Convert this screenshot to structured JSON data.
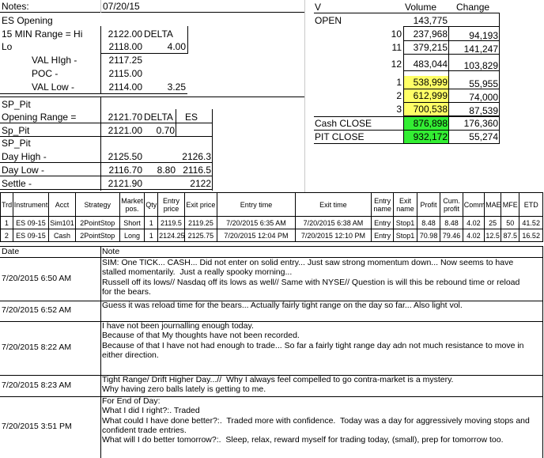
{
  "notes": {
    "label": "Notes:",
    "date": "07/20/15",
    "rows": [
      {
        "label": "ES Opening",
        "value": "",
        "extra_label": "",
        "extra_value": ""
      },
      {
        "label": "15 MIN Range = Hi",
        "value": "2122.00",
        "extra_label": "DELTA",
        "extra_value": ""
      },
      {
        "label": "Lo",
        "value": "2118.00",
        "extra_label": "",
        "extra_value": "4.00"
      },
      {
        "label": "VAL HIgh   -",
        "value": "2117.25",
        "extra_label": "",
        "extra_value": ""
      },
      {
        "label": "POC   -",
        "value": "2115.00",
        "extra_label": "",
        "extra_value": ""
      },
      {
        "label": "VAL Low   -",
        "value": "2114.00",
        "extra_label": "",
        "extra_value": "3.25"
      }
    ]
  },
  "sp_pit": {
    "title": "SP_Pit",
    "opening_range_label": "Opening Range =",
    "opening_range_value": "2121.70",
    "delta_label": "DELTA",
    "es_label": "ES",
    "sp_pit_label": "Sp_Pit",
    "sp_pit_value": "2121.00",
    "sp_pit_delta": "0.70",
    "title2": "SP_Pit",
    "day_high_label": "Day High -",
    "day_high_value": "2125.50",
    "day_high_es": "2126.3",
    "day_low_label": "Day Low -",
    "day_low_value": "2116.70",
    "day_low_delta": "8.80",
    "day_low_es": "2116.5",
    "settle_label": "Settle -",
    "settle_value": "2121.90",
    "settle_es": "2122"
  },
  "volume": {
    "header_v": "V",
    "header_volume": "Volume",
    "header_change": "Change",
    "open_label": "OPEN",
    "open_volume": "143,775",
    "rows": [
      {
        "hour": "10",
        "volume": "237,968",
        "change": "94,193",
        "highlight": ""
      },
      {
        "hour": "11",
        "volume": "379,215",
        "change": "141,247",
        "highlight": ""
      },
      {
        "hour": "12",
        "volume": "483,044",
        "change": "103,829",
        "highlight": ""
      },
      {
        "hour": "1",
        "volume": "538,999",
        "change": "55,955",
        "highlight": "#ffff66"
      },
      {
        "hour": "2",
        "volume": "612,999",
        "change": "74,000",
        "highlight": "#ffff66"
      },
      {
        "hour": "3",
        "volume": "700,538",
        "change": "87,539",
        "highlight": "#ffff66"
      }
    ],
    "cash_close_label": "Cash CLOSE",
    "cash_close_volume": "876,898",
    "cash_close_change": "176,360",
    "pit_close_label": "PIT CLOSE",
    "pit_close_volume": "932,172",
    "pit_close_change": "55,274"
  },
  "trades": {
    "headers": [
      "Trd",
      "Instrument",
      "Acct",
      "Strategy",
      "Market pos.",
      "Qty",
      "Entry price",
      "Exit price",
      "Entry time",
      "Exit time",
      "Entry name",
      "Exit name",
      "Profit",
      "Cum. profit",
      "Comm",
      "MAE",
      "MFE",
      "ETD"
    ],
    "rows": [
      [
        "1",
        "ES 09-15",
        "Sim101",
        "2PointStop",
        "Short",
        "1",
        "2119.5",
        "2119.25",
        "7/20/2015 6:35 AM",
        "7/20/2015 6:38 AM",
        "Entry",
        "Stop1",
        "8.48",
        "8.48",
        "4.02",
        "25",
        "50",
        "41.52"
      ],
      [
        "2",
        "ES 09-15",
        "Cash",
        "2PointStop",
        "Long",
        "1",
        "2124.25",
        "2125.75",
        "7/20/2015 12:04 PM",
        "7/20/2015 12:10 PM",
        "Entry",
        "Stop1",
        "70.98",
        "79.46",
        "4.02",
        "12.5",
        "87.5",
        "16.52"
      ]
    ]
  },
  "log": {
    "date_header": "Date",
    "note_header": "Note",
    "entries": [
      {
        "date": "7/20/2015 6:50 AM",
        "note": "SIM: One TICK... CASH... Did not enter on solid entry... Just saw strong momentum down... Now seems to have\nstalled momentarily.  Just a really spooky morning...\nRussell off its lows// Nasdaq off its lows as well// Same with NYSE// Question is will this be rebound time or reload\nfor the bears."
      },
      {
        "date": "7/20/2015 6:52 AM",
        "note": "Guess it was reload time for the bears... Actually fairly tight range on the day so far... Also light vol."
      },
      {
        "date": "7/20/2015 8:22 AM",
        "note": "I have not been journalling enough today.\nBecause of that My thoughts have not been recorded.\nBecause of that I have not had enough to trade... So far a fairly tight range day adn not much resistance to move in\neither direction."
      },
      {
        "date": "7/20/2015 8:23 AM",
        "note": "Tight Range/ Drift Higher Day...//  Why I always feel compelled to go contra-market is a mystery.\nWhy having zero balls lately is getting to me."
      },
      {
        "date": "7/20/2015 3:51 PM",
        "note": "For End of Day:\nWhat I did I right?:. Traded\nWhat could I have done better?:.  Traded more with confidence.  Today was a day for aggressively moving stops and\nconfident trade entries.\nWhat will I do better tomorrow?:.  Sleep, relax, reward myself for trading today, (small), prep for tomorrow too."
      }
    ]
  }
}
